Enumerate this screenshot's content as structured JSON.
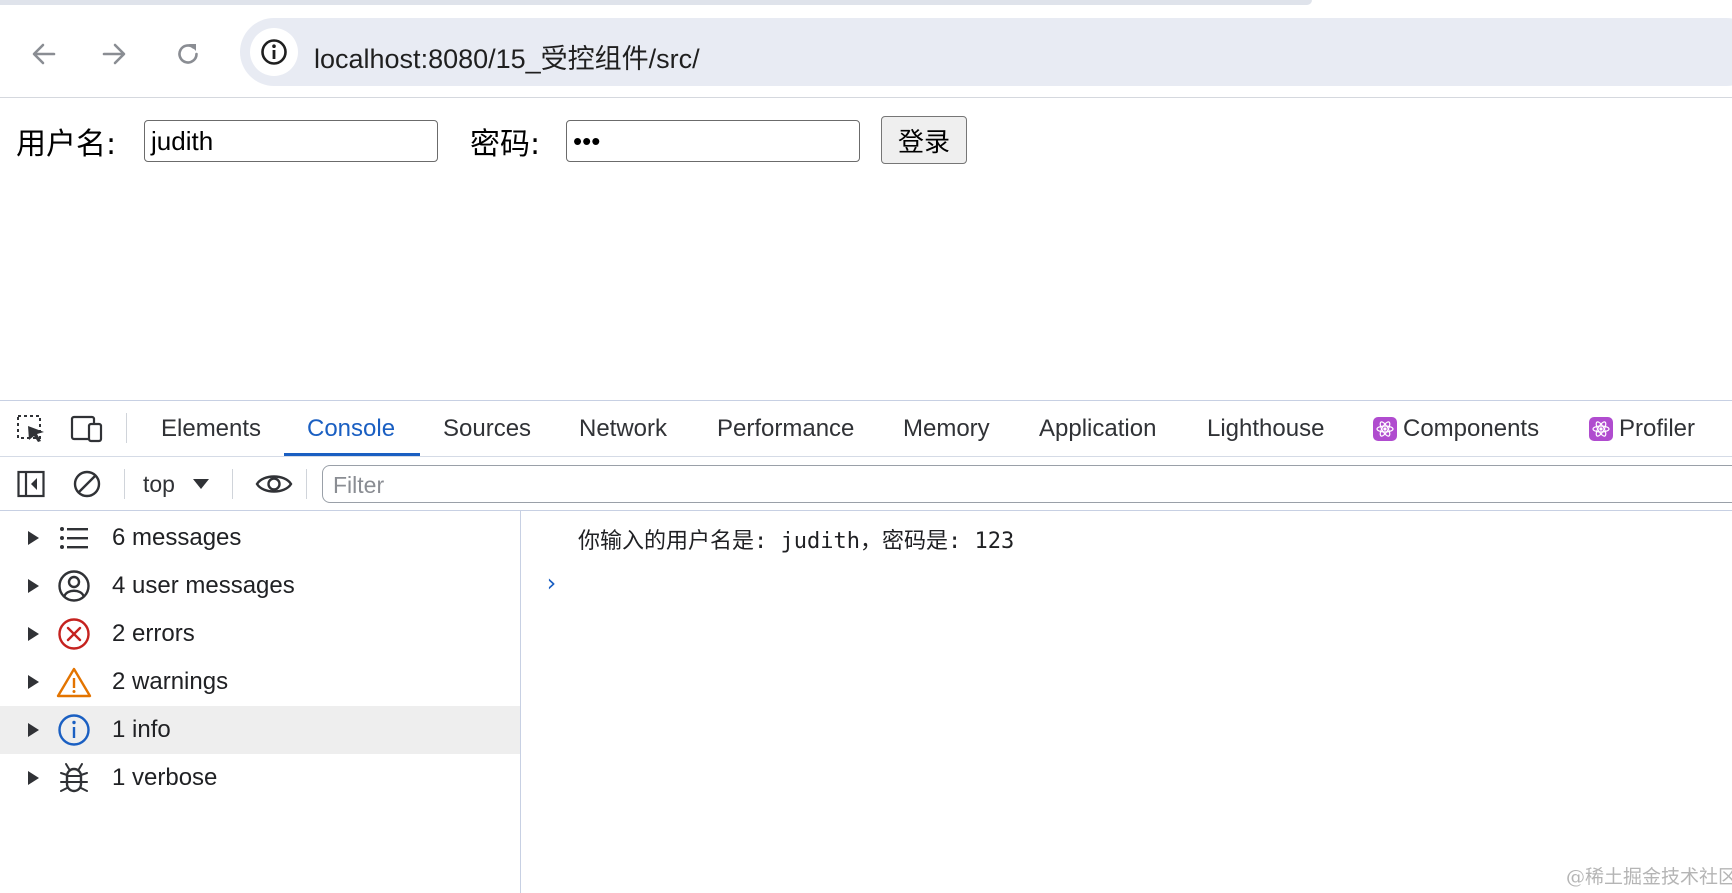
{
  "browser": {
    "url": "localhost:8080/15_受控组件/src/"
  },
  "form": {
    "username_label": "用户名:",
    "username_value": "judith",
    "password_label": "密码:",
    "password_value": "•••",
    "login_button": "登录"
  },
  "devtools": {
    "tabs": [
      {
        "label": "Elements"
      },
      {
        "label": "Console",
        "active": true
      },
      {
        "label": "Sources"
      },
      {
        "label": "Network"
      },
      {
        "label": "Performance"
      },
      {
        "label": "Memory"
      },
      {
        "label": "Application"
      },
      {
        "label": "Lighthouse"
      },
      {
        "label": "Components"
      },
      {
        "label": "Profiler"
      }
    ],
    "context": "top",
    "filter_placeholder": "Filter",
    "sidebar": [
      {
        "label": "6 messages",
        "icon": "list-icon"
      },
      {
        "label": "4 user messages",
        "icon": "user-circle-icon"
      },
      {
        "label": "2 errors",
        "icon": "error-icon"
      },
      {
        "label": "2 warnings",
        "icon": "warning-icon"
      },
      {
        "label": "1 info",
        "icon": "info-icon",
        "selected": true
      },
      {
        "label": "1 verbose",
        "icon": "bug-icon"
      }
    ],
    "log_message": "你输入的用户名是: judith，密码是: 123",
    "prompt": "›"
  },
  "colors": {
    "accent": "#1a5fc2",
    "error": "#c5221f",
    "warning": "#e37400",
    "info": "#1a5fc2",
    "react": "#b04ccf"
  },
  "watermark": "@稀土掘金技术社区"
}
